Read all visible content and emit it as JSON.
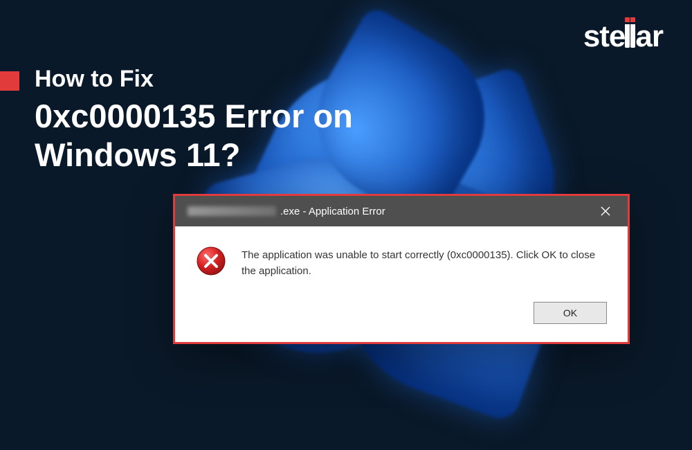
{
  "brand": "stellar",
  "heading": {
    "line1": "How to Fix",
    "line2": "0xc0000135 Error on",
    "line3": "Windows 11?"
  },
  "dialog": {
    "title_suffix": ".exe - Application Error",
    "body": "The application was unable to start correctly (0xc0000135). Click OK to close the application.",
    "ok_label": "OK"
  },
  "colors": {
    "accent": "#e23b3b",
    "titlebar": "#4f4f4f",
    "bg": "#0a1929"
  }
}
